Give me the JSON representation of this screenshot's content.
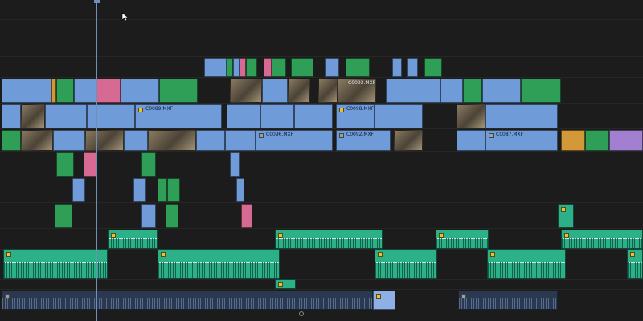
{
  "app": {
    "name": "Video editing timeline",
    "colors": {
      "background": "#1c1c1c",
      "video_clip": "#6f9bd8",
      "video_clip_green": "#2f9e56",
      "video_clip_pink": "#d66a92",
      "audio_clip": "#2bb087",
      "playhead": "#6f8fb8",
      "fx_badge": "#e8c040"
    }
  },
  "clip_labels": {
    "c1": "C0089.MXF",
    "c2": "C0098.MXF",
    "c3": "C0093.MXF",
    "c4": "C0096.MXF",
    "c5": "C0092.MXF",
    "c6": "C0087.MXF"
  },
  "icons": {
    "cursor": "mouse-pointer-icon",
    "effect": "fx-badge-icon",
    "scroll": "scroll-handle-icon"
  }
}
